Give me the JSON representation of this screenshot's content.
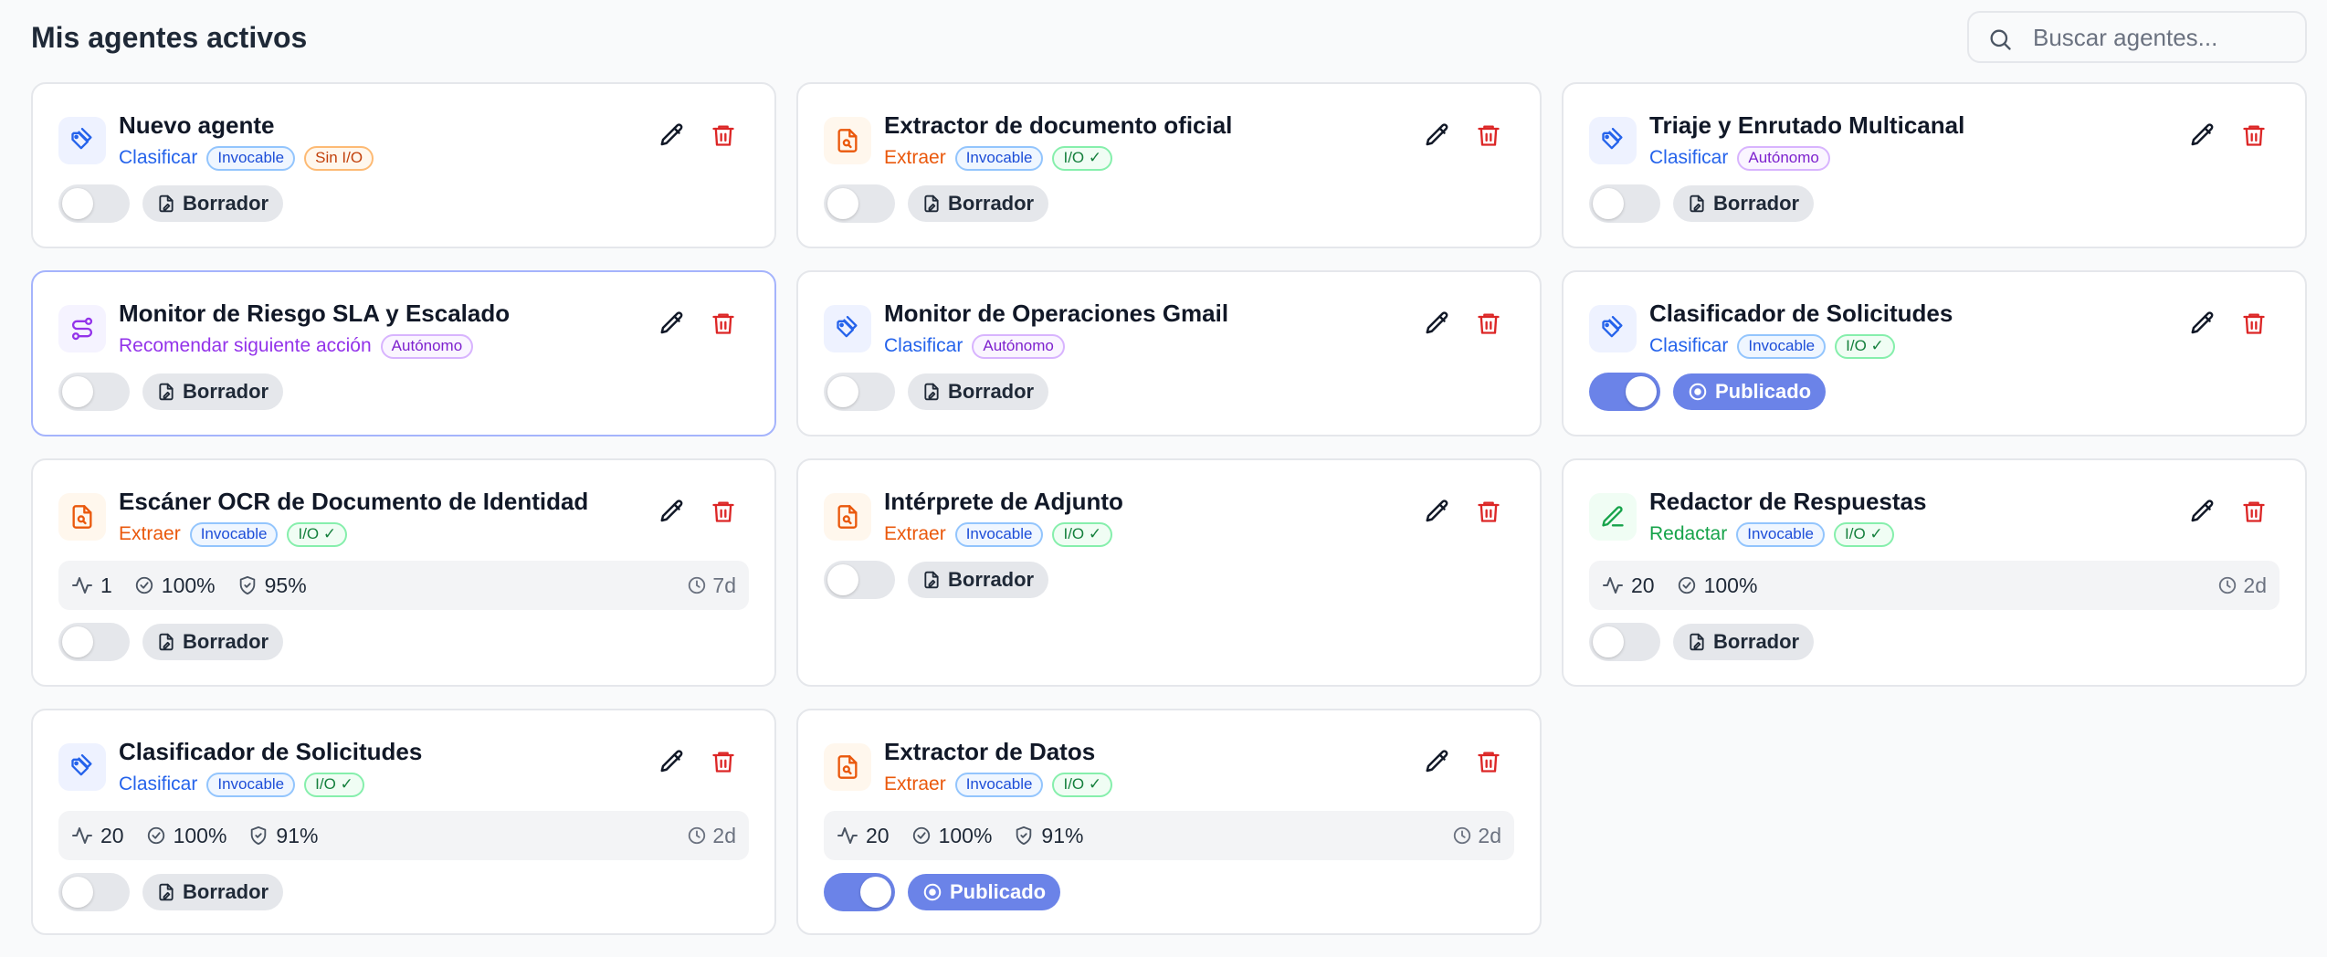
{
  "header": {
    "title": "Mis agentes activos",
    "search_placeholder": "Buscar agentes..."
  },
  "colors": {
    "accent": "#6b83e8",
    "delete": "#dc2626"
  },
  "agents": [
    {
      "name": "Nuevo agente",
      "type": "Clasificar",
      "type_color": "blue",
      "icon": "tag-icon",
      "badges": [
        {
          "label": "Invocable",
          "color": "blue"
        },
        {
          "label": "Sin I/O",
          "color": "orange"
        }
      ],
      "enabled": false,
      "status": "Borrador",
      "stats": null
    },
    {
      "name": "Extractor de documento oficial",
      "type": "Extraer",
      "type_color": "orange",
      "icon": "file-search-icon",
      "badges": [
        {
          "label": "Invocable",
          "color": "blue"
        },
        {
          "label": "I/O ✓",
          "color": "green"
        }
      ],
      "enabled": false,
      "status": "Borrador",
      "stats": null
    },
    {
      "name": "Triaje y Enrutado Multicanal",
      "type": "Clasificar",
      "type_color": "blue",
      "icon": "tag-icon",
      "badges": [
        {
          "label": "Autónomo",
          "color": "purple"
        }
      ],
      "enabled": false,
      "status": "Borrador",
      "stats": null
    },
    {
      "name": "Monitor de Riesgo SLA y Escalado",
      "type": "Recomendar siguiente acción",
      "type_color": "purple",
      "icon": "route-icon",
      "badges": [
        {
          "label": "Autónomo",
          "color": "purple"
        }
      ],
      "enabled": false,
      "status": "Borrador",
      "stats": null,
      "selected": true
    },
    {
      "name": "Monitor de Operaciones Gmail",
      "type": "Clasificar",
      "type_color": "blue",
      "icon": "tag-icon",
      "badges": [
        {
          "label": "Autónomo",
          "color": "purple"
        }
      ],
      "enabled": false,
      "status": "Borrador",
      "stats": null
    },
    {
      "name": "Clasificador de Solicitudes",
      "type": "Clasificar",
      "type_color": "blue",
      "icon": "tag-icon",
      "badges": [
        {
          "label": "Invocable",
          "color": "blue"
        },
        {
          "label": "I/O ✓",
          "color": "green"
        }
      ],
      "enabled": true,
      "status": "Publicado",
      "stats": null
    },
    {
      "name": "Escáner OCR de Documento de Identidad",
      "type": "Extraer",
      "type_color": "orange",
      "icon": "file-search-icon",
      "badges": [
        {
          "label": "Invocable",
          "color": "blue"
        },
        {
          "label": "I/O ✓",
          "color": "green"
        }
      ],
      "enabled": false,
      "status": "Borrador",
      "stats": {
        "runs": "1",
        "success": "100%",
        "accuracy": "95%",
        "age": "7d"
      }
    },
    {
      "name": "Intérprete de Adjunto",
      "type": "Extraer",
      "type_color": "orange",
      "icon": "file-search-icon",
      "badges": [
        {
          "label": "Invocable",
          "color": "blue"
        },
        {
          "label": "I/O ✓",
          "color": "green"
        }
      ],
      "enabled": false,
      "status": "Borrador",
      "stats": null
    },
    {
      "name": "Redactor de Respuestas",
      "type": "Redactar",
      "type_color": "green",
      "icon": "pencil-line-icon",
      "badges": [
        {
          "label": "Invocable",
          "color": "blue"
        },
        {
          "label": "I/O ✓",
          "color": "green"
        }
      ],
      "enabled": false,
      "status": "Borrador",
      "stats": {
        "runs": "20",
        "success": "100%",
        "accuracy": null,
        "age": "2d"
      }
    },
    {
      "name": "Clasificador de Solicitudes",
      "type": "Clasificar",
      "type_color": "blue",
      "icon": "tag-icon",
      "badges": [
        {
          "label": "Invocable",
          "color": "blue"
        },
        {
          "label": "I/O ✓",
          "color": "green"
        }
      ],
      "enabled": false,
      "status": "Borrador",
      "stats": {
        "runs": "20",
        "success": "100%",
        "accuracy": "91%",
        "age": "2d"
      }
    },
    {
      "name": "Extractor de Datos",
      "type": "Extraer",
      "type_color": "orange",
      "icon": "file-search-icon",
      "badges": [
        {
          "label": "Invocable",
          "color": "blue"
        },
        {
          "label": "I/O ✓",
          "color": "green"
        }
      ],
      "enabled": true,
      "status": "Publicado",
      "stats": {
        "runs": "20",
        "success": "100%",
        "accuracy": "91%",
        "age": "2d"
      }
    }
  ]
}
